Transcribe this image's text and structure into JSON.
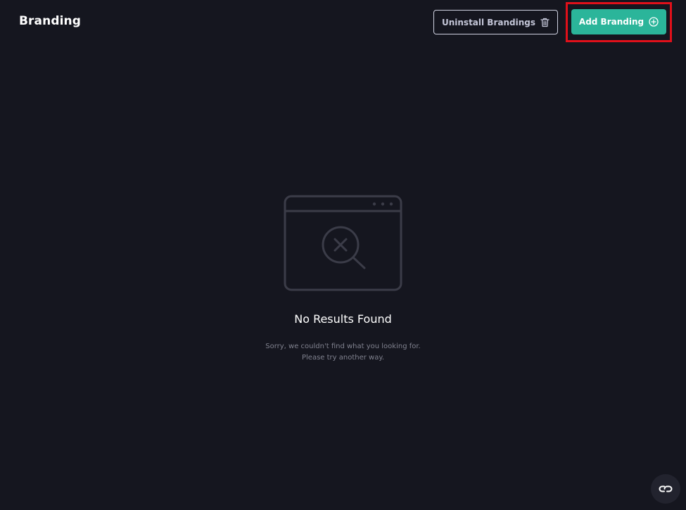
{
  "header": {
    "title": "Branding",
    "uninstall_label": "Uninstall Brandings",
    "uninstall_icon": "trash-icon",
    "add_label": "Add Branding",
    "add_icon": "plus-circle-icon"
  },
  "empty_state": {
    "illustration": "browser-search-no-results-icon",
    "title": "No Results Found",
    "message_line1": "Sorry, we couldn't find what you looking for.",
    "message_line2": "Please try another way."
  },
  "floating_button": {
    "icon": "link-icon"
  },
  "colors": {
    "background": "#15161f",
    "accent": "#2bb59a",
    "highlight": "#e0101a",
    "muted_text": "#80828f"
  }
}
